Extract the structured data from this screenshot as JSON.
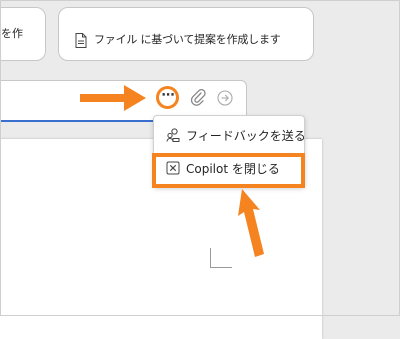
{
  "suggestion_cards": [
    {
      "label": "を作"
    },
    {
      "label": "ファイル に基づいて提案を作成します",
      "icon": "document-icon"
    }
  ],
  "chat_input": {
    "more_icon": "more-horizontal-icon",
    "more_label": "⋯",
    "attach_icon": "paperclip-icon",
    "send_icon": "send-arrow-icon"
  },
  "menu": {
    "items": [
      {
        "label": "フィードバックを送る",
        "icon": "feedback-icon"
      },
      {
        "label": "Copilot を閉じる",
        "icon": "close-box-icon"
      }
    ]
  },
  "annotation": {
    "accent_color": "#f5831f"
  },
  "colors": {
    "background": "#ebebeb",
    "focus_underline": "#3a6fd0"
  }
}
